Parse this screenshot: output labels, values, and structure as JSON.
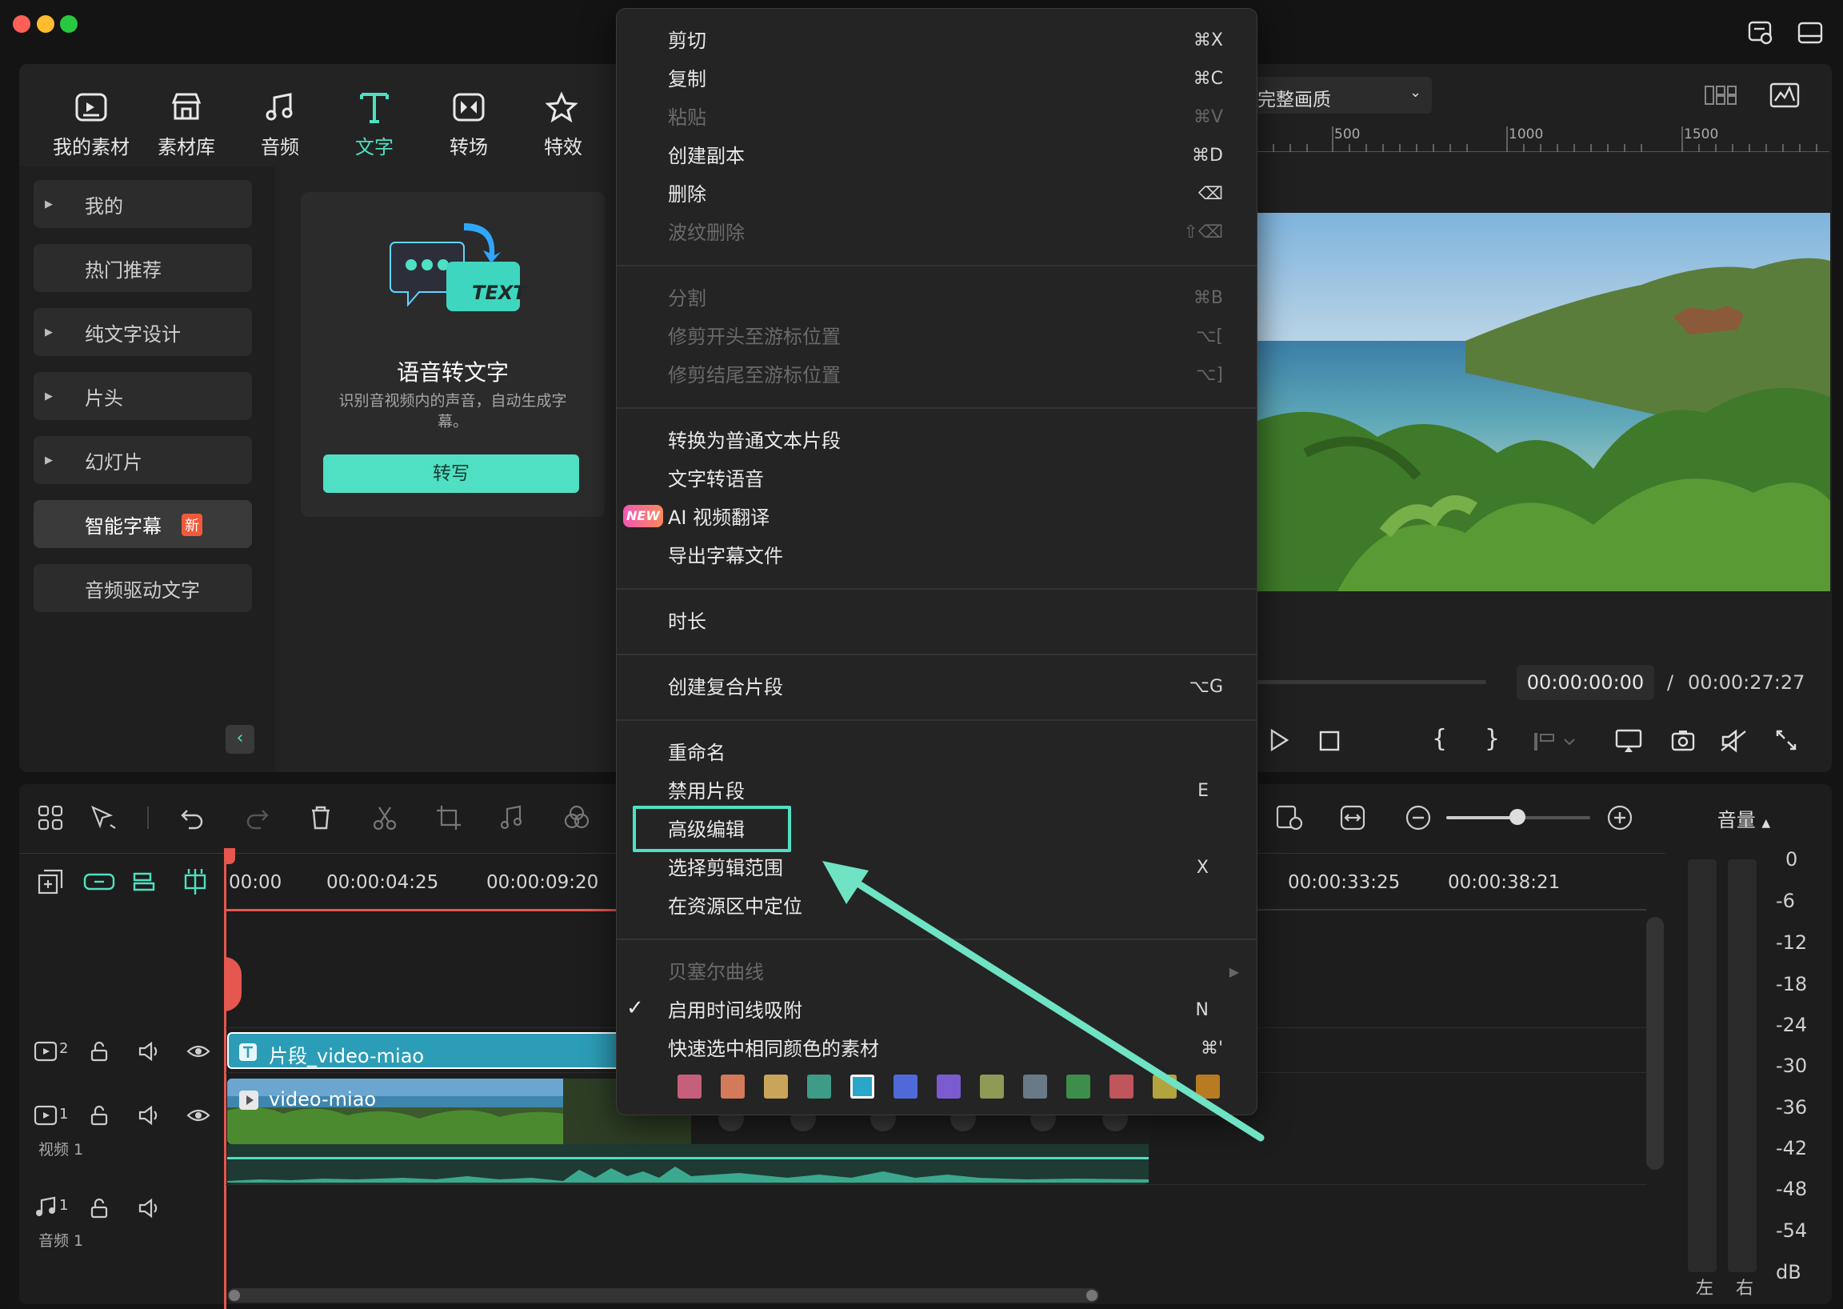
{
  "media_tabs": [
    {
      "label": "我的素材",
      "icon": "my-media-icon"
    },
    {
      "label": "素材库",
      "icon": "store-icon"
    },
    {
      "label": "音频",
      "icon": "music-note-icon"
    },
    {
      "label": "文字",
      "icon": "text-t-icon"
    },
    {
      "label": "转场",
      "icon": "transition-icon"
    },
    {
      "label": "特效",
      "icon": "effects-star-icon"
    }
  ],
  "categories": [
    "我的",
    "热门推荐",
    "纯文字设计",
    "片头",
    "幻灯片",
    "智能字幕",
    "音频驱动文字"
  ],
  "new_badge": "新",
  "stt_card": {
    "icon_text": "TEXT",
    "title": "语音转文字",
    "desc": "识别音视频内的声音，自动生成字幕。",
    "button": "转写"
  },
  "preview": {
    "quality": "完整画质",
    "ruler": [
      "500",
      "1000",
      "1500"
    ],
    "current_time": "00:00:00:00",
    "separator": "/",
    "total_time": "00:00:27:27"
  },
  "menu": {
    "items": [
      {
        "label": "剪切",
        "shortcut": "⌘X"
      },
      {
        "label": "复制",
        "shortcut": "⌘C"
      },
      {
        "label": "粘贴",
        "shortcut": "⌘V"
      },
      {
        "label": "创建副本",
        "shortcut": "⌘D"
      },
      {
        "label": "删除",
        "shortcut": "⌫"
      },
      {
        "label": "波纹删除",
        "shortcut": "⇧⌫"
      },
      {
        "label": "分割",
        "shortcut": "⌘B"
      },
      {
        "label": "修剪开头至游标位置",
        "shortcut": "⌥["
      },
      {
        "label": "修剪结尾至游标位置",
        "shortcut": "⌥]"
      },
      {
        "label": "转换为普通文本片段",
        "shortcut": ""
      },
      {
        "label": "文字转语音",
        "shortcut": ""
      },
      {
        "label": "AI 视频翻译",
        "shortcut": ""
      },
      {
        "label": "导出字幕文件",
        "shortcut": ""
      },
      {
        "label": "时长",
        "shortcut": ""
      },
      {
        "label": "创建复合片段",
        "shortcut": "⌥G"
      },
      {
        "label": "重命名",
        "shortcut": ""
      },
      {
        "label": "禁用片段",
        "shortcut": "E"
      },
      {
        "label": "高级编辑",
        "shortcut": ""
      },
      {
        "label": "选择剪辑范围",
        "shortcut": "X"
      },
      {
        "label": "在资源区中定位",
        "shortcut": ""
      },
      {
        "label": "贝塞尔曲线",
        "shortcut": ""
      },
      {
        "label": "启用时间线吸附",
        "shortcut": "N"
      },
      {
        "label": "快速选中相同颜色的素材",
        "shortcut": "⌘'"
      }
    ],
    "new_badge": "NEW",
    "swatches": [
      "#c55f7a",
      "#d37a5a",
      "#c9a559",
      "#3e9b86",
      "#2aa6c9",
      "#4f6ad8",
      "#7b5bd0",
      "#8e9a55",
      "#687a88",
      "#3d8e4a",
      "#c0555b",
      "#b3a33c",
      "#b87b22"
    ]
  },
  "timeline": {
    "times": [
      "00:00",
      "00:00:04:25",
      "00:00:09:20",
      "00:00:33:25",
      "00:00:38:21"
    ],
    "tracks": [
      {
        "num": "2",
        "name": ""
      },
      {
        "num": "1",
        "name": "视频 1"
      },
      {
        "num": "1",
        "name": "音频 1"
      }
    ],
    "clip_text": "片段_video-miao",
    "clip_video": "video-miao",
    "volume_label": "音量",
    "vu_scale": [
      "0",
      "-6",
      "-12",
      "-18",
      "-24",
      "-30",
      "-36",
      "-42",
      "-48",
      "-54",
      "dB"
    ],
    "vu_left": "左",
    "vu_right": "右"
  }
}
